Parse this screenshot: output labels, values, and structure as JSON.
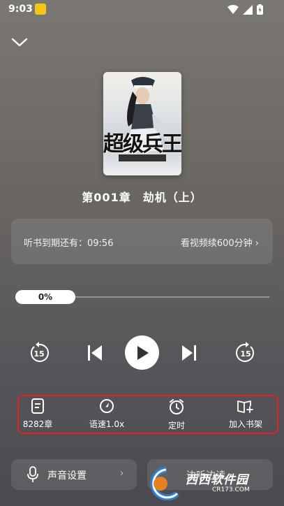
{
  "status_bar": {
    "time": "9:03"
  },
  "book": {
    "cover_title": "超级兵王",
    "cover_author": "",
    "chapter_title": "第001章　劫机（上）"
  },
  "membership": {
    "expire_text": "听书到期还有：09:56",
    "extend_link": "看视频续600分钟 ›"
  },
  "progress": {
    "percent_label": "0%",
    "value": 0
  },
  "controls": {
    "rewind_seconds": "15",
    "forward_seconds": "15"
  },
  "tools": [
    {
      "label": "8282章",
      "icon": "catalog-icon"
    },
    {
      "label": "语速1.0x",
      "icon": "speed-icon"
    },
    {
      "label": "定时",
      "icon": "alarm-clock-icon"
    },
    {
      "label": "加入书架",
      "icon": "add-bookshelf-icon"
    }
  ],
  "bottom": {
    "voice_settings": "声音设置",
    "voice_chevron": "›",
    "listen_read": "边听边读"
  },
  "watermark": {
    "text": "西西软件园",
    "url": "CR173.COM"
  },
  "colors": {
    "highlight_border": "#e02222",
    "play_button": "#ffffff"
  }
}
